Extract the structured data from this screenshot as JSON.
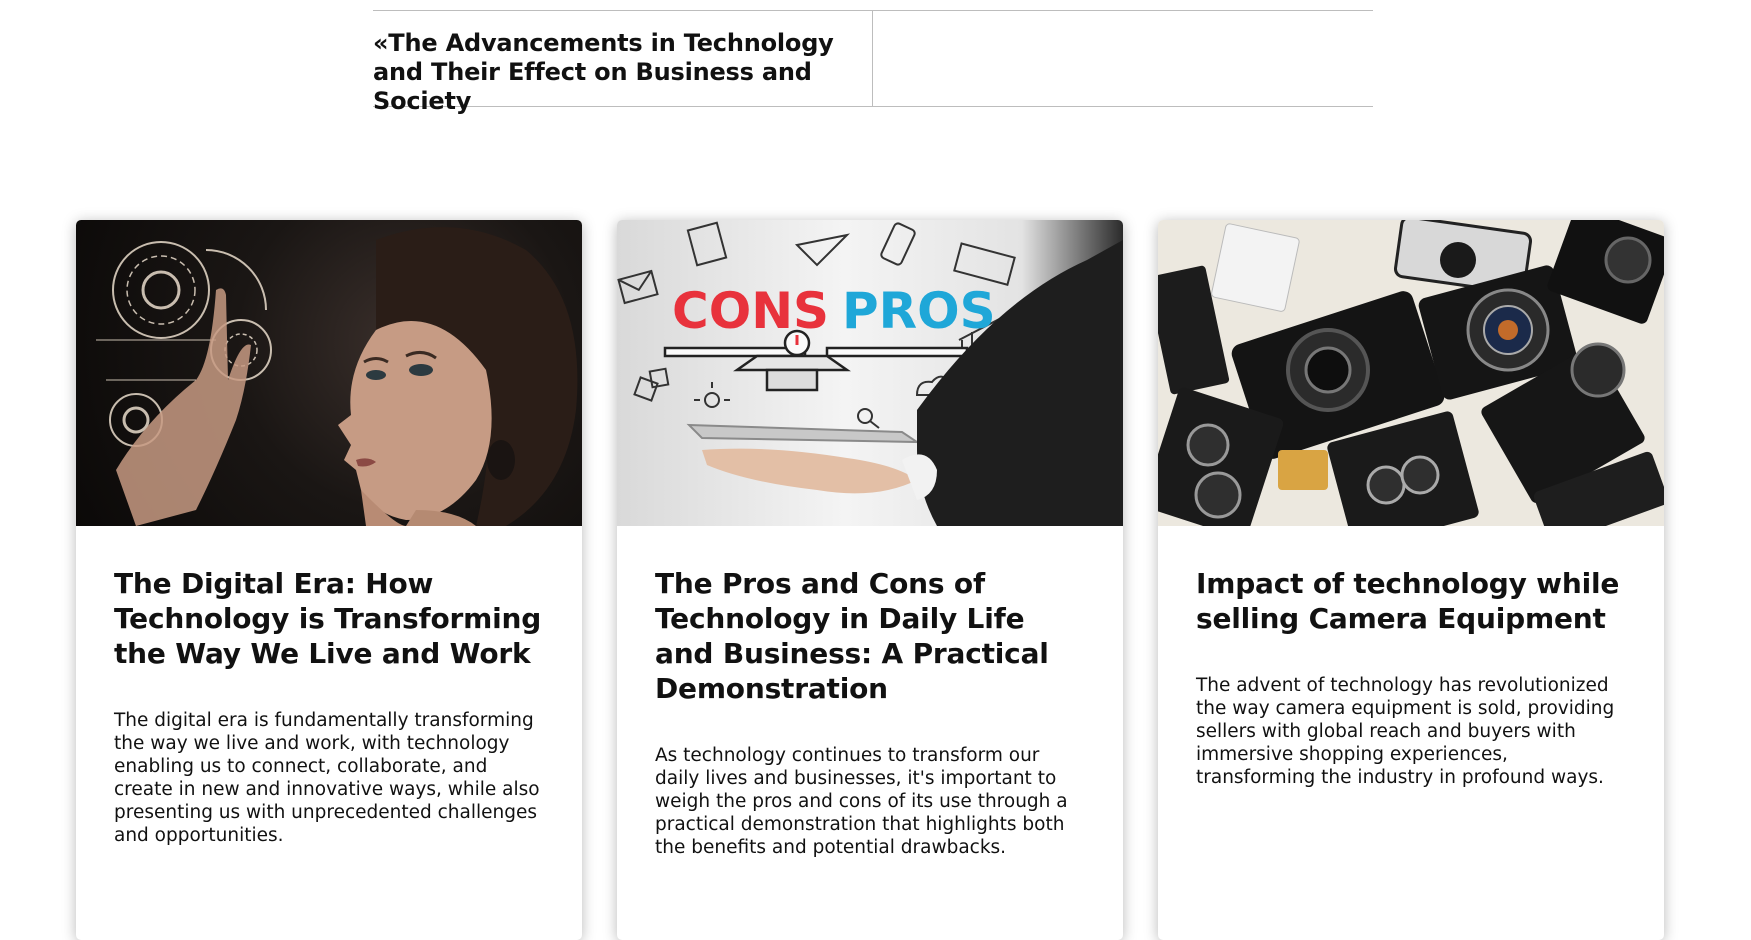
{
  "post_navigation": {
    "previous_label": "«The Advancements in Technology and Their Effect on Business and Society"
  },
  "cards": [
    {
      "title": "The Digital Era: How Technology is Transforming the Way We Live and Work",
      "excerpt": "The digital era is fundamentally transforming the way we live and work, with technology enabling us to connect, collaborate, and create in new and innovative ways, while also presenting us with unprecedented challenges and opportunities."
    },
    {
      "title": "The Pros and Cons of Technology in Daily Life and Business: A Practical Demonstration",
      "excerpt": "As technology continues to transform our daily lives and businesses, it's important to weigh the pros and cons of its use through a practical demonstration that highlights both the benefits and potential drawbacks.",
      "image_text": {
        "cons": "CONS",
        "pros": "PROS"
      }
    },
    {
      "title": "Impact of technology while selling Camera Equipment",
      "excerpt": "The advent of technology has revolutionized the way camera equipment is sold, providing sellers with global reach and buyers with immersive shopping experiences, transforming the industry in profound ways."
    }
  ],
  "colors": {
    "cons_red": "#e8323c",
    "pros_blue": "#1fa7d8",
    "divider": "#bdbdbd"
  }
}
